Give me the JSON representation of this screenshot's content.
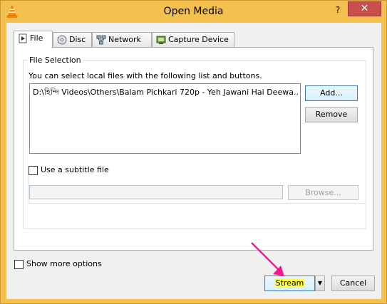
{
  "window": {
    "title": "Open Media",
    "help_glyph": "?",
    "close_glyph": "✕"
  },
  "tabs": [
    {
      "label": "File",
      "icon": "file-icon"
    },
    {
      "label": "Disc",
      "icon": "disc-icon"
    },
    {
      "label": "Network",
      "icon": "network-icon"
    },
    {
      "label": "Capture Device",
      "icon": "capture-device-icon"
    }
  ],
  "file_selection": {
    "group_label": "File Selection",
    "hint": "You can select local files with the following list and buttons.",
    "files": [
      "D:\\হিন্দি Videos\\Others\\Balam Pichkari 720p - Yeh Jawani Hai Deewa..."
    ],
    "add_label": "Add...",
    "remove_label": "Remove"
  },
  "subtitle": {
    "checkbox_label": "Use a subtitle file",
    "checked": false,
    "path_value": "",
    "browse_label": "Browse..."
  },
  "footer": {
    "show_more_label": "Show more options",
    "show_more_checked": false,
    "stream_label": "Stream",
    "dropdown_glyph": "▼",
    "cancel_label": "Cancel"
  },
  "colors": {
    "titlebar": "#f3bf4d",
    "close": "#c7504a",
    "annotation_arrow": "#ff1493",
    "stream_highlight": "#ffff4d"
  }
}
